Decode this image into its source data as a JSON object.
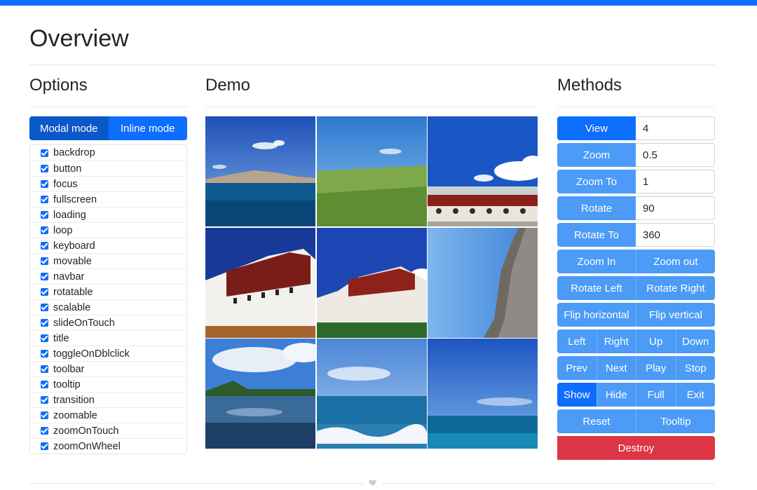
{
  "page": {
    "title": "Overview"
  },
  "sections": {
    "options": "Options",
    "demo": "Demo",
    "methods": "Methods"
  },
  "modes": {
    "modal": "Modal mode",
    "inline": "Inline mode"
  },
  "options": [
    "backdrop",
    "button",
    "focus",
    "fullscreen",
    "loading",
    "loop",
    "keyboard",
    "movable",
    "navbar",
    "rotatable",
    "scalable",
    "slideOnTouch",
    "title",
    "toggleOnDblclick",
    "toolbar",
    "tooltip",
    "transition",
    "zoomable",
    "zoomOnTouch",
    "zoomOnWheel"
  ],
  "methods": {
    "view": {
      "label": "View",
      "value": "4"
    },
    "zoom": {
      "label": "Zoom",
      "value": "0.5"
    },
    "zoom_to": {
      "label": "Zoom To",
      "value": "1"
    },
    "rotate": {
      "label": "Rotate",
      "value": "90"
    },
    "rotate_to": {
      "label": "Rotate To",
      "value": "360"
    },
    "zoom_in": "Zoom In",
    "zoom_out": "Zoom out",
    "rotate_left": "Rotate Left",
    "rotate_right": "Rotate Right",
    "flip_h": "Flip horizontal",
    "flip_v": "Flip vertical",
    "left": "Left",
    "right": "Right",
    "up": "Up",
    "down": "Down",
    "prev": "Prev",
    "next": "Next",
    "play": "Play",
    "stop": "Stop",
    "show": "Show",
    "hide": "Hide",
    "full": "Full",
    "exit": "Exit",
    "reset": "Reset",
    "tooltip": "Tooltip",
    "destroy": "Destroy"
  },
  "colors": {
    "primary": "#0d6efd",
    "primary_dark": "#0a58ca",
    "light_btn": "#4b9bf7",
    "danger": "#dc3545"
  },
  "icons": {
    "footer": "heart-icon"
  }
}
